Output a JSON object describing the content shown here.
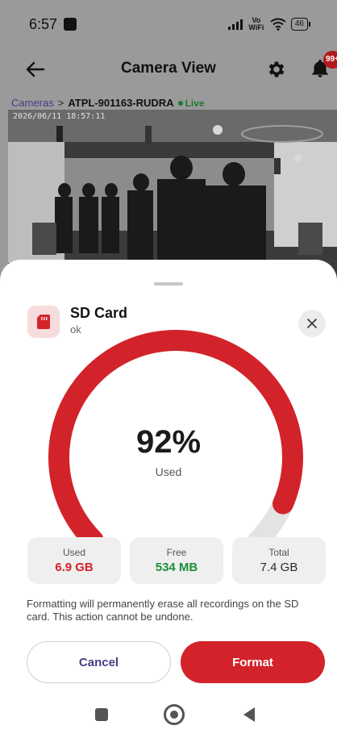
{
  "status_bar": {
    "time": "6:57",
    "network_label": "Vo WiFi",
    "battery": "46"
  },
  "app_bar": {
    "title": "Camera View",
    "notification_count": "99+"
  },
  "breadcrumb": {
    "root": "Cameras",
    "separator": ">",
    "current": "ATPL-901163-RUDRA",
    "live_label": "Live"
  },
  "camera": {
    "timestamp": "2026/06/11 18:57:11"
  },
  "sd_card": {
    "title": "SD Card",
    "status": "ok",
    "used_percent_text": "92%",
    "used_fraction": 0.92,
    "gauge_label": "Used",
    "stats": [
      {
        "label": "Used",
        "value": "6.9 GB"
      },
      {
        "label": "Free",
        "value": "534 MB"
      },
      {
        "label": "Total",
        "value": "7.4 GB"
      }
    ],
    "warning": "Formatting will permanently erase all recordings on the SD card. This action cannot be undone.",
    "cancel_label": "Cancel",
    "format_label": "Format"
  },
  "colors": {
    "accent_red": "#d3232a",
    "free_green": "#1c8f3c",
    "link_purple": "#4a3b86",
    "track_gray": "#e3e3e3"
  },
  "icons": {
    "back": "arrow-left-icon",
    "settings": "gear-icon",
    "notifications": "bell-icon",
    "sd": "sd-card-icon",
    "close": "close-icon"
  }
}
